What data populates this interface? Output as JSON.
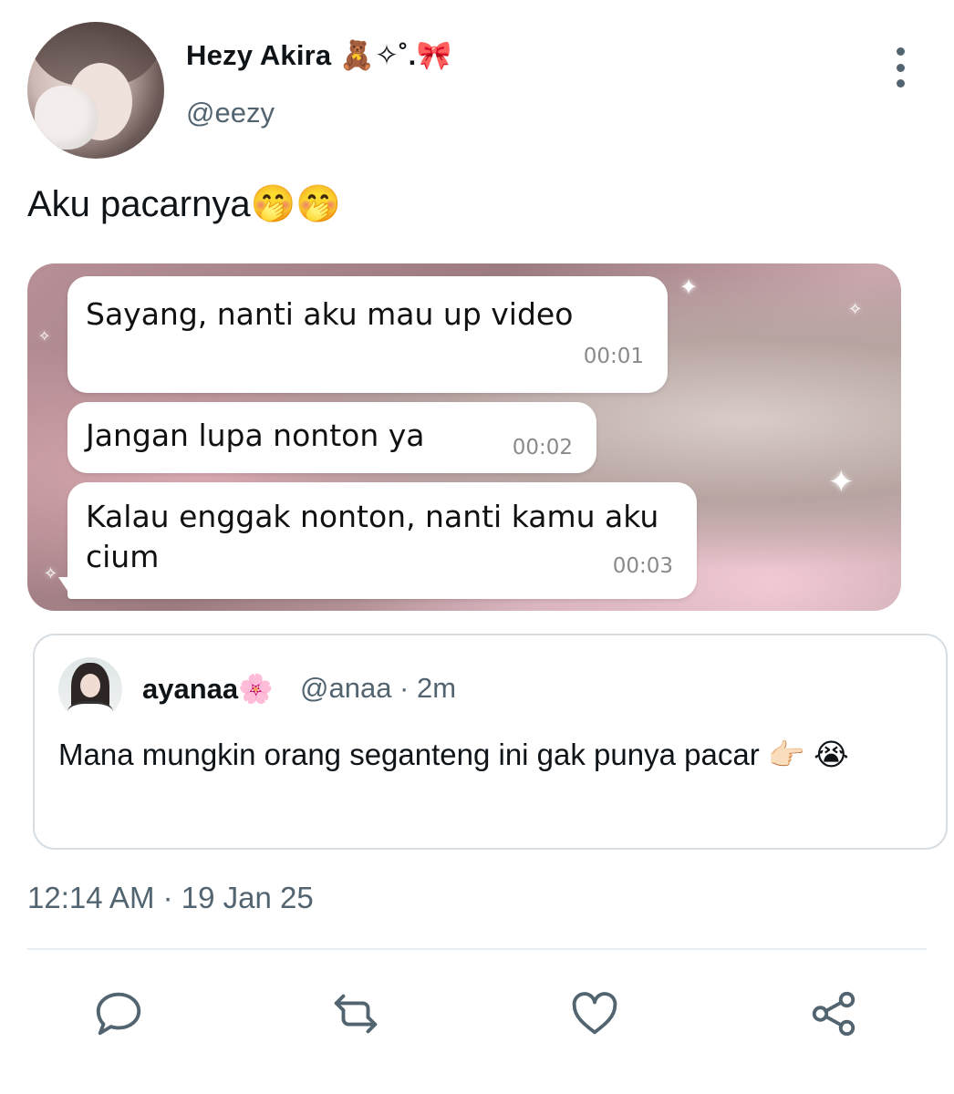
{
  "author": {
    "display_name": "Hezy Akira 🧸✧˚.🎀",
    "handle": "@eezy"
  },
  "tweet": {
    "text": "Aku pacarnya🤭🤭",
    "timestamp": "12:14 AM · 19 Jan 25"
  },
  "media": {
    "messages": [
      {
        "text": "Sayang, nanti aku mau up video",
        "time": "00:01"
      },
      {
        "text": "Jangan lupa nonton ya",
        "time": "00:02"
      },
      {
        "text": "Kalau enggak nonton, nanti kamu aku cium",
        "time": "00:03"
      }
    ]
  },
  "quoted": {
    "name": "ayanaa🌸",
    "meta": "@anaa · 2m",
    "text": "Mana mungkin orang seganteng ini gak punya pacar 👉🏻 😭"
  },
  "icons": {
    "more": "more-vertical-icon",
    "reply": "reply-icon",
    "retweet": "retweet-icon",
    "like": "heart-icon",
    "share": "share-icon"
  },
  "colors": {
    "text": "#0f1419",
    "secondary": "#536471",
    "border": "#d7dee3"
  }
}
